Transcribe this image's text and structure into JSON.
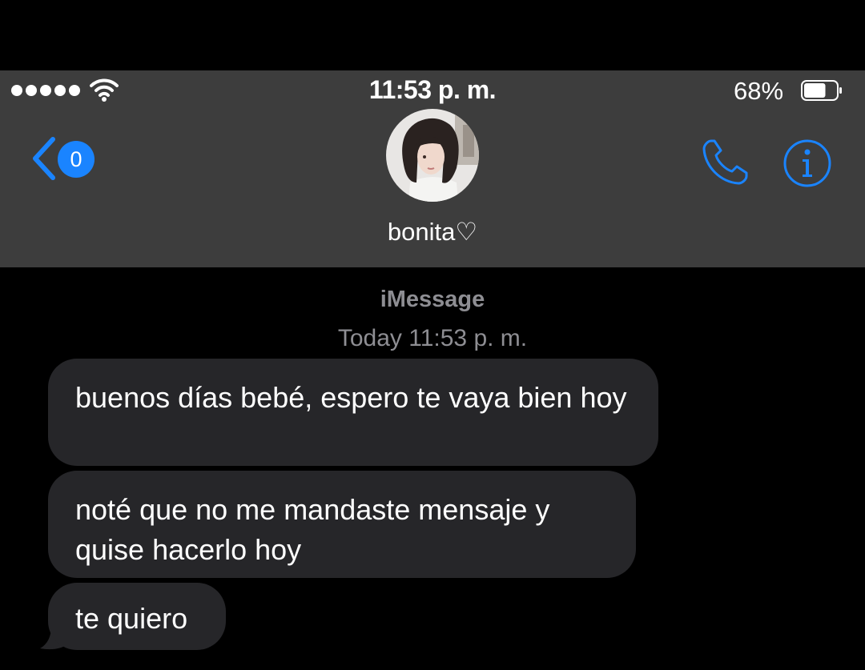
{
  "status_bar": {
    "time": "11:53 p. m.",
    "battery_percent": "68%",
    "battery_level": 0.68,
    "signal_bars": 5
  },
  "nav": {
    "back_badge_count": "0",
    "contact_name": "bonita♡",
    "accent_color": "#1a84ff",
    "header_bg": "#3d3d3d"
  },
  "icons": {
    "back": "chevron-left-icon",
    "call": "phone-icon",
    "info": "info-icon"
  },
  "conversation": {
    "service": "iMessage",
    "timestamp": "Today 11:53 p. m.",
    "bubble_color": "#262629",
    "messages": [
      {
        "text": "buenos días bebé, espero te vaya bien hoy"
      },
      {
        "text": "noté que no me mandaste mensaje y quise hacerlo hoy"
      },
      {
        "text": "te quiero"
      }
    ]
  }
}
